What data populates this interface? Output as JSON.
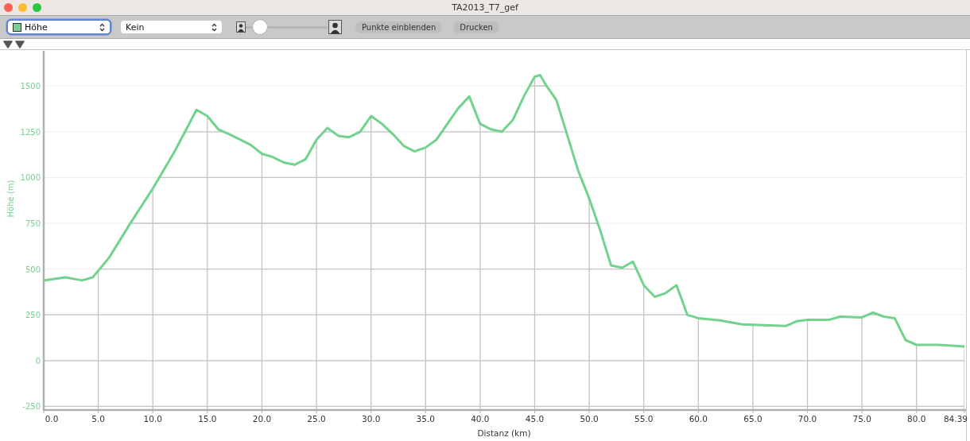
{
  "window": {
    "title": "TA2013_T7_gef"
  },
  "toolbar": {
    "data_select": {
      "focused": true
    },
    "overlay_select": {
      "value": "Kein"
    },
    "zoom_slider": {
      "level": 0.1
    },
    "buttons": [
      "Punkte einblenden",
      "Drucken"
    ]
  },
  "chart_data": {
    "type": "line",
    "grid": true,
    "xlabel": "Distanz (km)",
    "ylabel": "Höhe (m)",
    "ylim": [
      -270,
      1692
    ],
    "xlim": [
      0,
      84.39
    ],
    "yticks": [
      -250,
      0,
      250,
      500,
      750,
      1000,
      1250,
      1500
    ],
    "xticks": [
      {
        "value": 0,
        "label": "0.0"
      },
      {
        "value": 5,
        "label": "5.0"
      },
      {
        "value": 10,
        "label": "10.0"
      },
      {
        "value": 15,
        "label": "15.0"
      },
      {
        "value": 20,
        "label": "20.0"
      },
      {
        "value": 25,
        "label": "25.0"
      },
      {
        "value": 30,
        "label": "30.0"
      },
      {
        "value": 35,
        "label": "35.0"
      },
      {
        "value": 40,
        "label": "40.0"
      },
      {
        "value": 45,
        "label": "45.0"
      },
      {
        "value": 50,
        "label": "50.0"
      },
      {
        "value": 55,
        "label": "55.0"
      },
      {
        "value": 60,
        "label": "60.0"
      },
      {
        "value": 65,
        "label": "65.0"
      },
      {
        "value": 70,
        "label": "70.0"
      },
      {
        "value": 75,
        "label": "75.0"
      },
      {
        "value": 80,
        "label": "80.0"
      },
      {
        "value": 84.39,
        "label": "84.39"
      }
    ],
    "x": [
      0,
      2,
      3.5,
      4.5,
      6,
      8,
      10,
      12,
      14,
      15,
      16,
      17,
      18,
      19,
      20,
      21,
      22,
      23,
      24,
      25,
      26,
      27,
      28,
      29,
      30,
      31,
      32,
      33,
      34,
      35,
      36,
      37,
      38,
      39,
      40,
      41,
      42,
      43,
      44,
      45,
      45.5,
      46,
      47,
      48,
      49,
      50,
      51,
      52,
      53,
      54,
      55,
      56,
      57,
      58,
      59,
      60,
      62,
      64,
      66,
      68,
      69,
      70,
      72,
      73,
      75,
      76,
      77,
      78,
      79,
      80,
      82,
      84.39
    ],
    "series": [
      {
        "name": "Höhe",
        "color": "#72d28e",
        "values": [
          438,
          455,
          438,
          455,
          563,
          756,
          940,
          1143,
          1370,
          1336,
          1263,
          1237,
          1207,
          1177,
          1130,
          1112,
          1082,
          1070,
          1100,
          1207,
          1271,
          1228,
          1220,
          1250,
          1336,
          1293,
          1237,
          1173,
          1143,
          1164,
          1207,
          1293,
          1379,
          1443,
          1293,
          1263,
          1250,
          1314,
          1443,
          1551,
          1560,
          1508,
          1422,
          1228,
          1035,
          885,
          713,
          520,
          507,
          541,
          412,
          348,
          369,
          412,
          249,
          232,
          219,
          198,
          193,
          189,
          215,
          223,
          223,
          240,
          236,
          262,
          240,
          232,
          112,
          86,
          86,
          77
        ]
      }
    ]
  }
}
